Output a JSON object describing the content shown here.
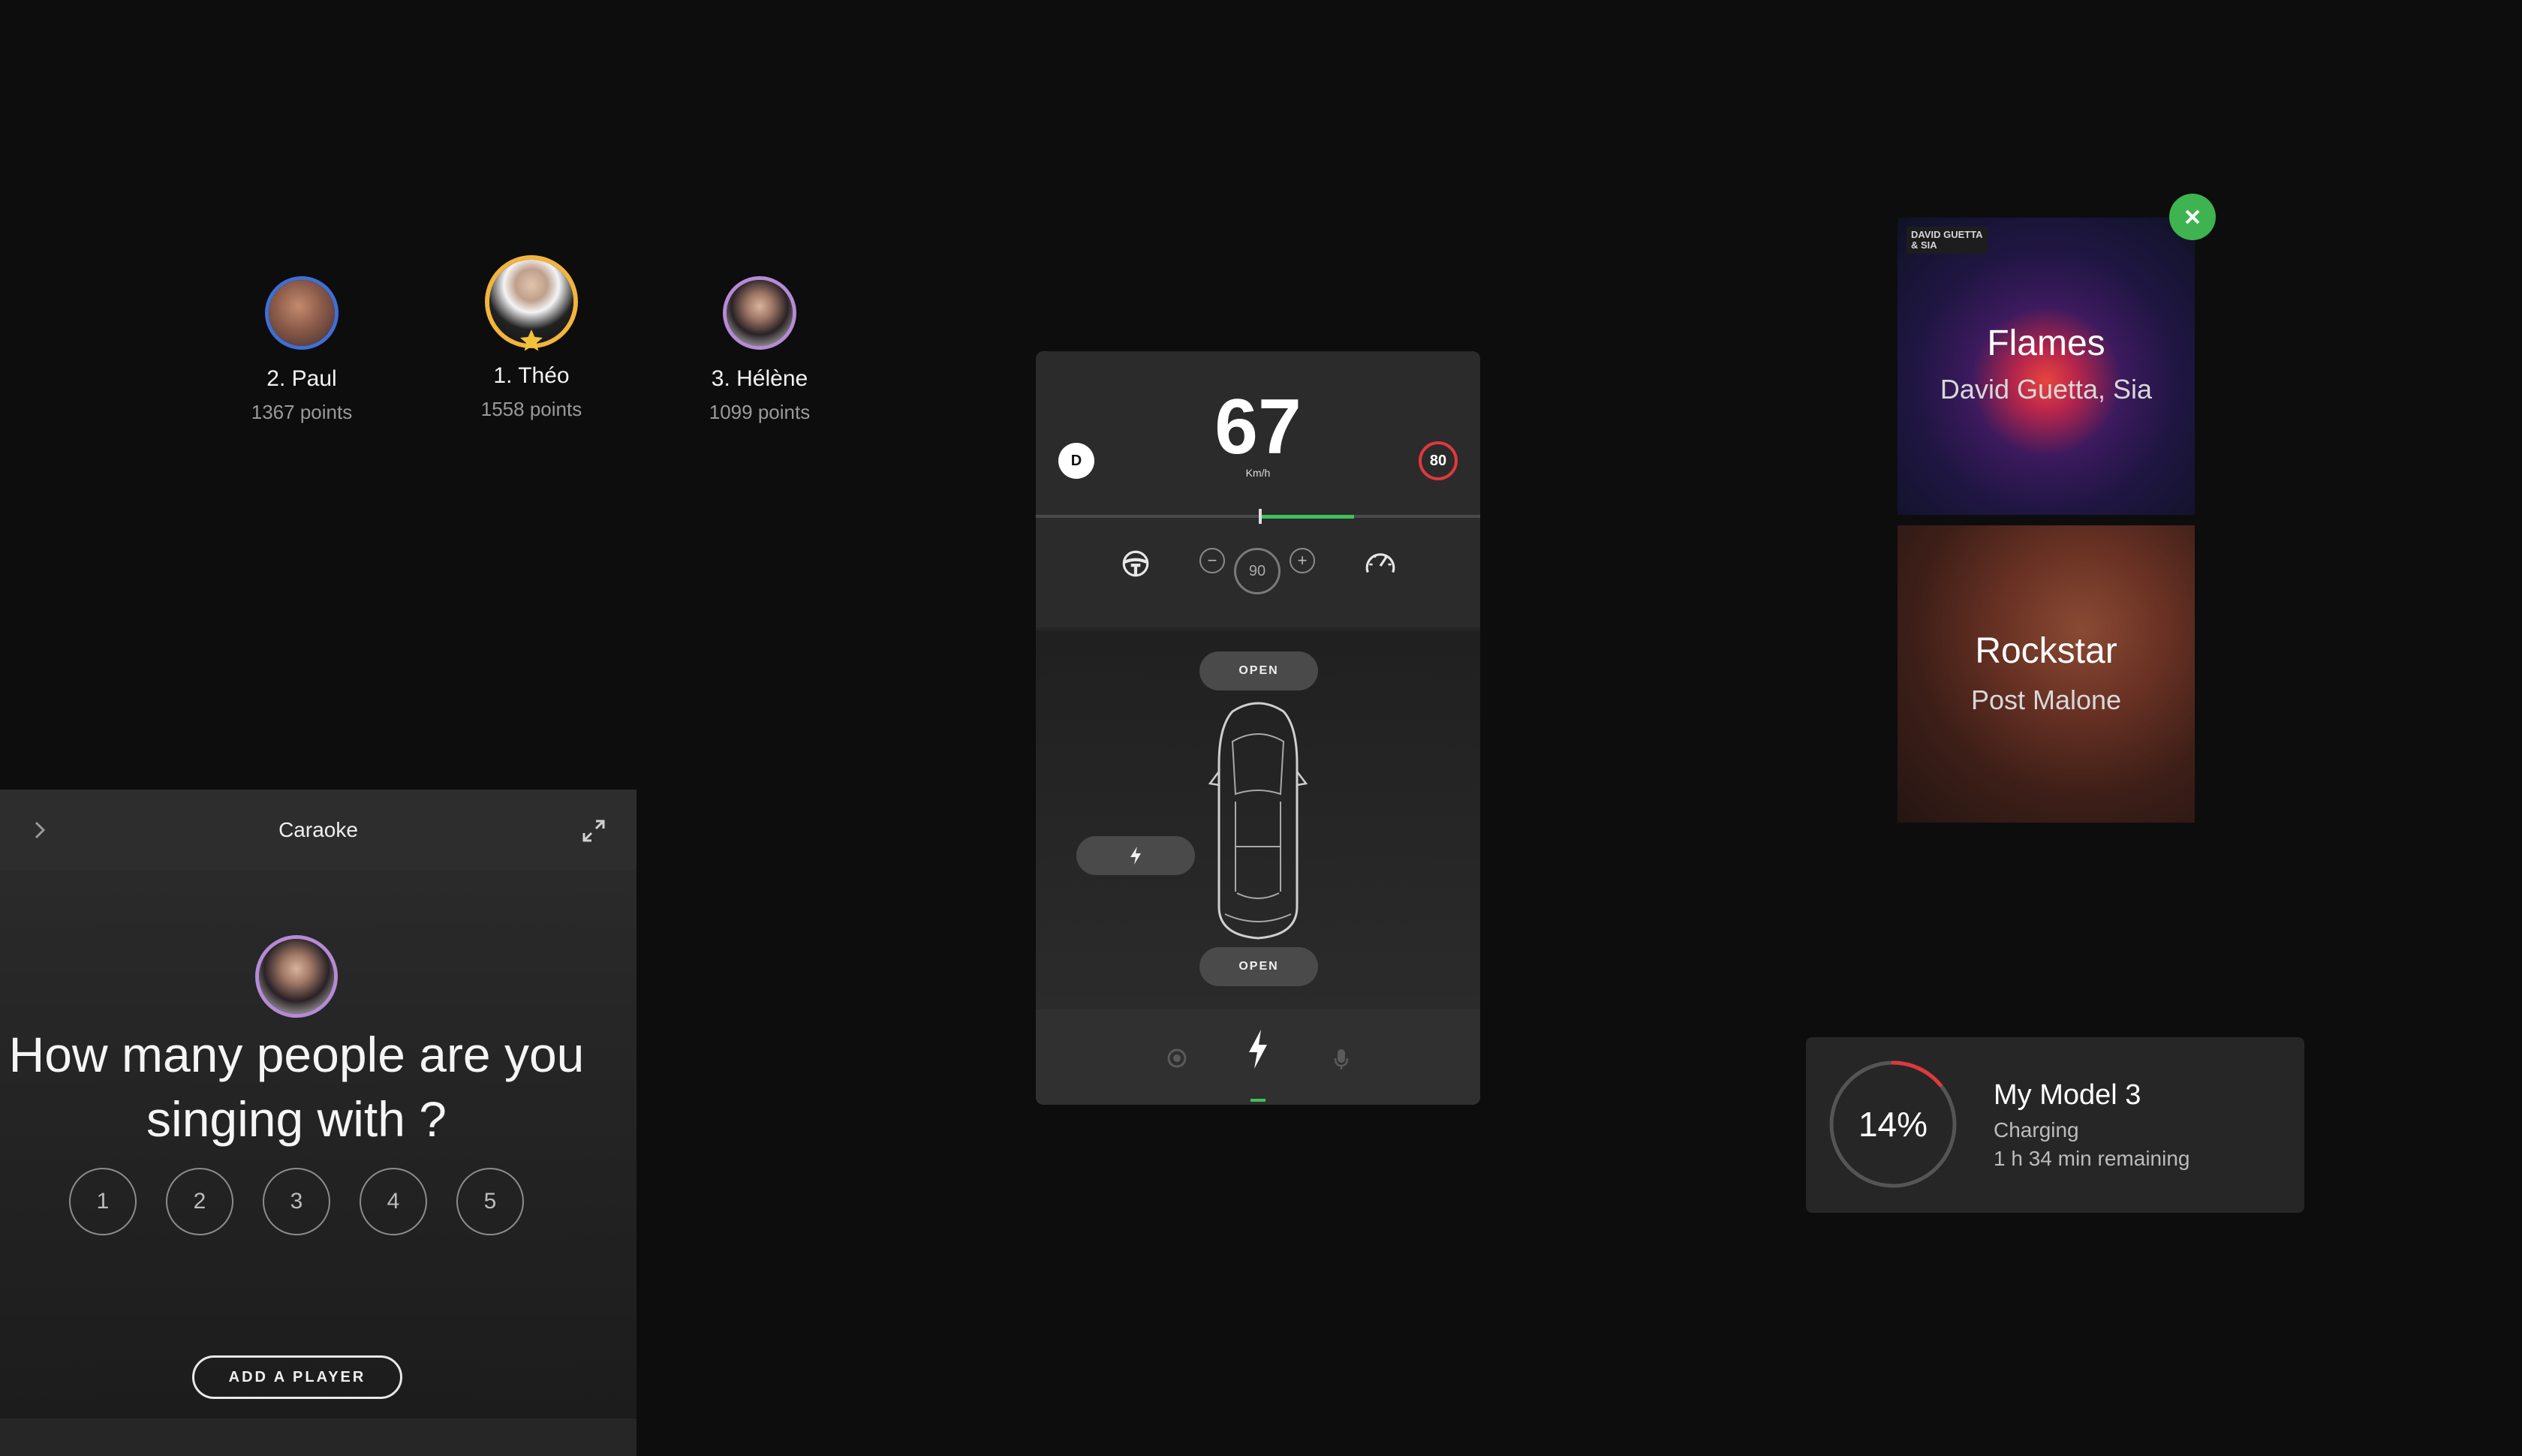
{
  "leaderboard": {
    "players": [
      {
        "rank_name": "2. Paul",
        "points": "1367 points",
        "ring_color": "#3f6fd6"
      },
      {
        "rank_name": "1. Théo",
        "points": "1558 points",
        "ring_color": "#f2b43c"
      },
      {
        "rank_name": "3. Hélène",
        "points": "1099 points",
        "ring_color": "#b58ad6"
      }
    ]
  },
  "karaoke": {
    "title": "Caraoke",
    "question": "How many people are you singing with ?",
    "choices": [
      "1",
      "2",
      "3",
      "4",
      "5"
    ],
    "add_player_label": "ADD A PLAYER"
  },
  "car": {
    "gear": "D",
    "speed": "67",
    "speed_unit": "Km/h",
    "speed_limit": "80",
    "cruise_speed": "90",
    "minus_label": "−",
    "plus_label": "+",
    "frunk_label": "OPEN",
    "trunk_label": "OPEN",
    "accent_color": "#3ec15a"
  },
  "songs": [
    {
      "title": "Flames",
      "artist": "David Guetta, Sia",
      "cover_text": "DAVID GUETTA & SIA"
    },
    {
      "title": "Rockstar",
      "artist": "Post Malone"
    }
  ],
  "charging": {
    "percent": "14%",
    "percent_value": 14,
    "car_name": "My Model 3",
    "status": "Charging",
    "remaining": "1 h 34 min remaining",
    "ring_color": "#e0383e"
  }
}
